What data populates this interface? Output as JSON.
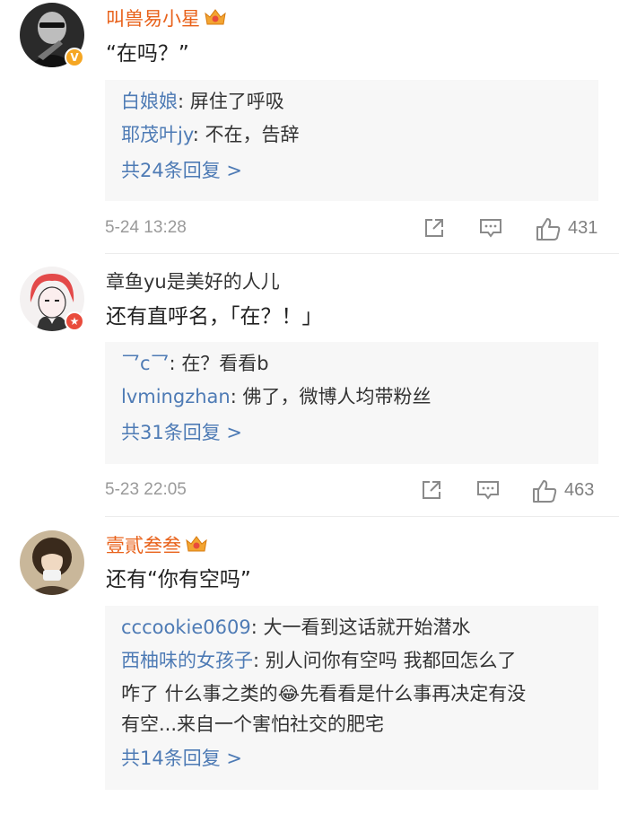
{
  "comments": [
    {
      "username": "叫兽易小星",
      "text": "“在吗？”",
      "replies": [
        {
          "user": "白娘娘",
          "sep": ": ",
          "text": "屏住了呼吸"
        },
        {
          "user": "耶茂叶jy",
          "sep": ": ",
          "text": "不在，告辞"
        }
      ],
      "more_replies": "共24条回复 >",
      "timestamp": "5-24 13:28",
      "likes": "431"
    },
    {
      "username": "章鱼yu是美好的人儿",
      "text": "还有直呼名，「在？！」",
      "replies": [
        {
          "user": "乛c乛",
          "sep": ": ",
          "text": "在？看看b"
        },
        {
          "user": "lvmingzhan",
          "sep": ": ",
          "text": "佛了，微博人均带粉丝"
        }
      ],
      "more_replies": "共31条回复 >",
      "timestamp": "5-23 22:05",
      "likes": "463"
    },
    {
      "username": "壹貳叁叁",
      "text": "还有“你有空吗”",
      "replies": [
        {
          "user": "cccookie0609",
          "sep": ": ",
          "text": "大一看到这话就开始潜水"
        },
        {
          "user": "西柚味的女孩子",
          "sep": ": ",
          "text": "别人问你有空吗 我都回怎么了"
        },
        {
          "user": "",
          "sep": "",
          "text": "咋了 什么事之类的😂先看看是什么事再决定有没"
        },
        {
          "user": "",
          "sep": "",
          "text": "有空...来自一个害怕社交的肥宅"
        }
      ],
      "more_replies": "共14条回复 >",
      "timestamp": "",
      "likes": ""
    }
  ],
  "icons": {
    "share": "share-icon",
    "comment": "comment-icon",
    "like": "like-icon",
    "crown": "crown-icon",
    "verified": "verified-badge-icon",
    "star": "star-badge-icon"
  },
  "colors": {
    "vip_name": "#e8611a",
    "reply_user": "#4e7bb5",
    "reply_bg": "#f7f7f7",
    "meta_gray": "#9a9a9a",
    "verified_badge": "#f5a623",
    "star_badge": "#e94b3c"
  }
}
